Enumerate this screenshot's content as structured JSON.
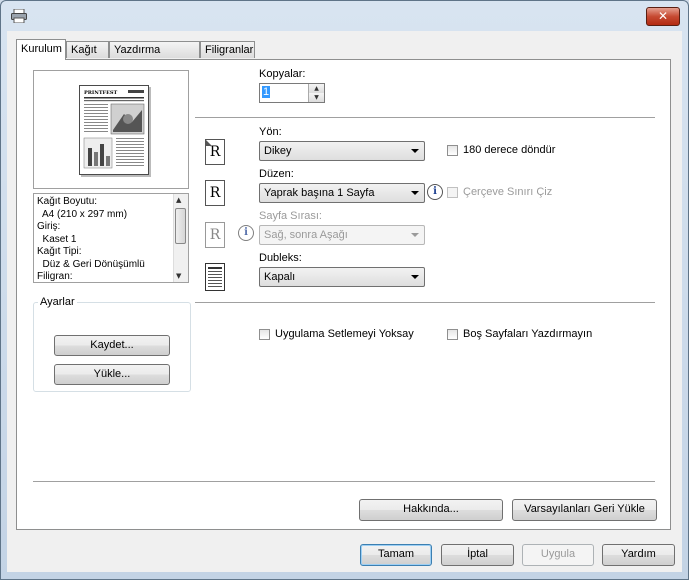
{
  "window": {
    "close_label": "✕"
  },
  "tabs": [
    {
      "label": "Kurulum"
    },
    {
      "label": "Kağıt"
    },
    {
      "label": "Yazdırma Kalitesi"
    },
    {
      "label": "Filigranlar"
    }
  ],
  "preview": {
    "newsletter_title": "PRINTFEST"
  },
  "info_lines": [
    "Kağıt Boyutu:",
    "  A4 (210 x 297 mm)",
    "Giriş:",
    "  Kaset 1",
    "Kağıt Tipi:",
    "  Düz & Geri Dönüşümlü",
    "Filigran:"
  ],
  "ayarlar": {
    "title": "Ayarlar",
    "save_label": "Kaydet...",
    "load_label": "Yükle..."
  },
  "copies": {
    "label": "Kopyalar:",
    "value": "1"
  },
  "orientation": {
    "label": "Yön:",
    "value": "Dikey",
    "rotate_label": "180 derece döndür"
  },
  "layout": {
    "label": "Düzen:",
    "value": "Yaprak başına 1 Sayfa",
    "border_label": "Çerçeve Sınırı Çiz"
  },
  "page_order": {
    "label": "Sayfa Sırası:",
    "value": "Sağ, sonra Aşağı"
  },
  "duplex": {
    "label": "Dubleks:",
    "value": "Kapalı"
  },
  "ignore_app_label": "Uygulama Setlemeyi Yoksay",
  "skip_blank_label": "Boş Sayfaları Yazdırmayın",
  "panel_buttons": {
    "about": "Hakkında...",
    "restore": "Varsayılanları Geri Yükle"
  },
  "dialog_buttons": {
    "ok": "Tamam",
    "cancel": "İptal",
    "apply": "Uygula",
    "help": "Yardım"
  },
  "icons": {
    "orientation_glyph": "R",
    "info_glyph": "i"
  }
}
